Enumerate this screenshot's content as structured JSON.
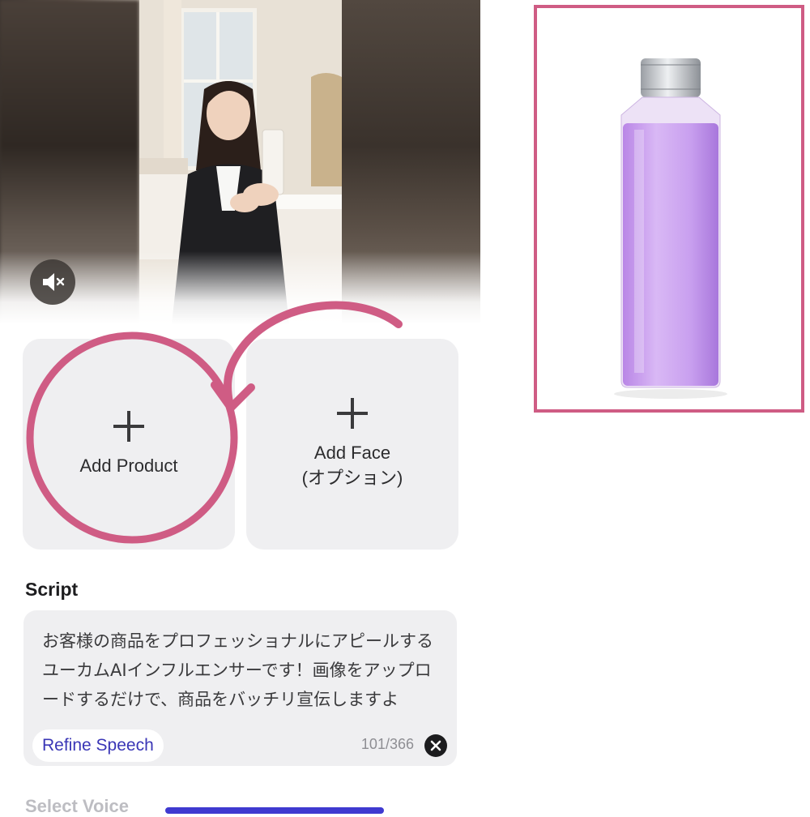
{
  "video": {
    "mute_icon": "speaker-muted-icon"
  },
  "cards": [
    {
      "icon": "plus-icon",
      "label": "Add Product"
    },
    {
      "icon": "plus-icon",
      "label": "Add Face",
      "sublabel": "(オプション)"
    }
  ],
  "script": {
    "heading": "Script",
    "text": "お客様の商品をプロフェッショナルにアピールするユーカムAIインフルエンサーです！画像をアップロードするだけで、商品をバッチリ宣伝しますよ",
    "refine_label": "Refine Speech",
    "counter": "101/366",
    "clear_icon": "close-circle-icon"
  },
  "voice": {
    "heading": "Select Voice"
  },
  "annotation": {
    "color": "#cf5c84",
    "icons": [
      "circle-highlight",
      "curved-arrow-icon"
    ]
  },
  "colors": {
    "accent": "#3a36b6",
    "highlight": "#cf5c84",
    "card_bg": "#efeff1"
  }
}
